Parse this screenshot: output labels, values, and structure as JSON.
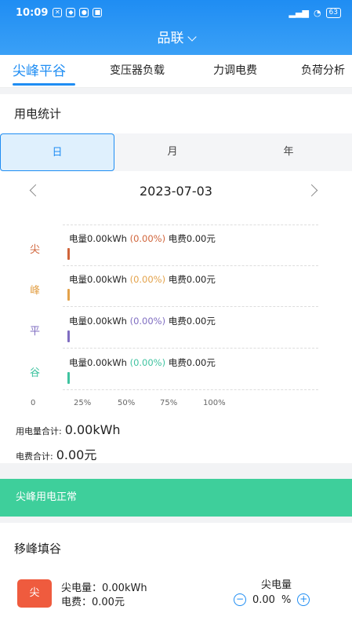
{
  "status_bar": {
    "time": "10:09",
    "battery": "63"
  },
  "header": {
    "title": "品联"
  },
  "tabs": [
    {
      "label": "尖峰平谷",
      "active": true
    },
    {
      "label": "变压器负载",
      "active": false
    },
    {
      "label": "力调电费",
      "active": false
    },
    {
      "label": "负荷分析",
      "active": false
    }
  ],
  "usage": {
    "section_title": "用电统计",
    "periods": [
      "日",
      "月",
      "年"
    ],
    "selected_period": "日",
    "date": "2023-07-03",
    "rows": [
      {
        "category": "尖",
        "energy_text": "电量0.00kWh",
        "percent_text": "(0.00%)",
        "fee_text": "电费0.00元",
        "color": "#d0643a",
        "fraction": 0
      },
      {
        "category": "峰",
        "energy_text": "电量0.00kWh",
        "percent_text": "(0.00%)",
        "fee_text": "电费0.00元",
        "color": "#e3a24a",
        "fraction": 0
      },
      {
        "category": "平",
        "energy_text": "电量0.00kWh",
        "percent_text": "(0.00%)",
        "fee_text": "电费0.00元",
        "color": "#7f6dc1",
        "fraction": 0
      },
      {
        "category": "谷",
        "energy_text": "电量0.00kWh",
        "percent_text": "(0.00%)",
        "fee_text": "电费0.00元",
        "color": "#3fc3a0",
        "fraction": 0
      }
    ],
    "axis_ticks": [
      "0",
      "25%",
      "50%",
      "75%",
      "100%"
    ],
    "total_energy_label": "用电量合计:",
    "total_energy_value": "0.00kWh",
    "total_fee_label": "电费合计:",
    "total_fee_value": "0.00元"
  },
  "notice": {
    "text": "尖峰用电正常"
  },
  "shift": {
    "section_title": "移峰填谷",
    "item": {
      "badge": "尖",
      "energy_line": "尖电量：0.00kWh",
      "fee_line": "电费：0.00元",
      "control_label": "尖电量",
      "control_value": "0.00",
      "control_unit": "%",
      "minus": "−",
      "plus": "+"
    }
  }
}
